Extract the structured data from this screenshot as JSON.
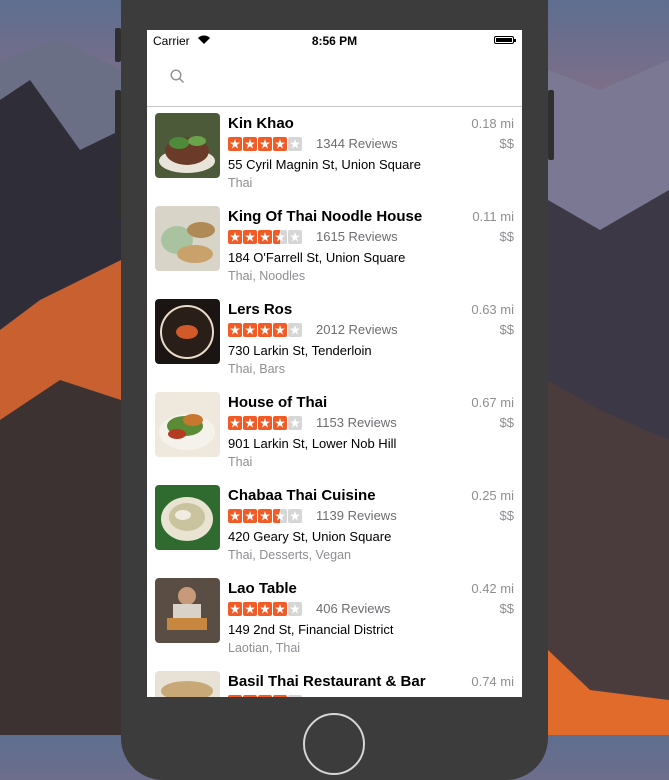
{
  "status_bar": {
    "carrier": "Carrier",
    "time": "8:56 PM"
  },
  "search": {
    "placeholder": ""
  },
  "colors": {
    "star_filled": "#f15c26",
    "star_empty": "#d6d6d6",
    "secondary_text": "#8e8e93"
  },
  "restaurants": [
    {
      "name": "Kin Khao",
      "rating": 4,
      "reviews": "1344 Reviews",
      "address": "55 Cyril Magnin St, Union Square",
      "categories": "Thai",
      "distance": "0.18 mi",
      "price": "$$"
    },
    {
      "name": "King Of Thai Noodle House",
      "rating": 3.5,
      "reviews": "1615 Reviews",
      "address": "184 O'Farrell St, Union Square",
      "categories": "Thai, Noodles",
      "distance": "0.11 mi",
      "price": "$$"
    },
    {
      "name": "Lers Ros",
      "rating": 4,
      "reviews": "2012 Reviews",
      "address": "730 Larkin St, Tenderloin",
      "categories": "Thai, Bars",
      "distance": "0.63 mi",
      "price": "$$"
    },
    {
      "name": "House of Thai",
      "rating": 4,
      "reviews": "1153 Reviews",
      "address": "901 Larkin St, Lower Nob Hill",
      "categories": "Thai",
      "distance": "0.67 mi",
      "price": "$$"
    },
    {
      "name": "Chabaa Thai Cuisine",
      "rating": 3.5,
      "reviews": "1139 Reviews",
      "address": "420 Geary St, Union Square",
      "categories": "Thai, Desserts, Vegan",
      "distance": "0.25 mi",
      "price": "$$"
    },
    {
      "name": "Lao Table",
      "rating": 4,
      "reviews": "406 Reviews",
      "address": "149 2nd St, Financial District",
      "categories": "Laotian, Thai",
      "distance": "0.42 mi",
      "price": "$$"
    },
    {
      "name": "Basil Thai Restaurant & Bar",
      "rating": 4,
      "reviews": "",
      "address": "",
      "categories": "",
      "distance": "0.74 mi",
      "price": ""
    }
  ]
}
